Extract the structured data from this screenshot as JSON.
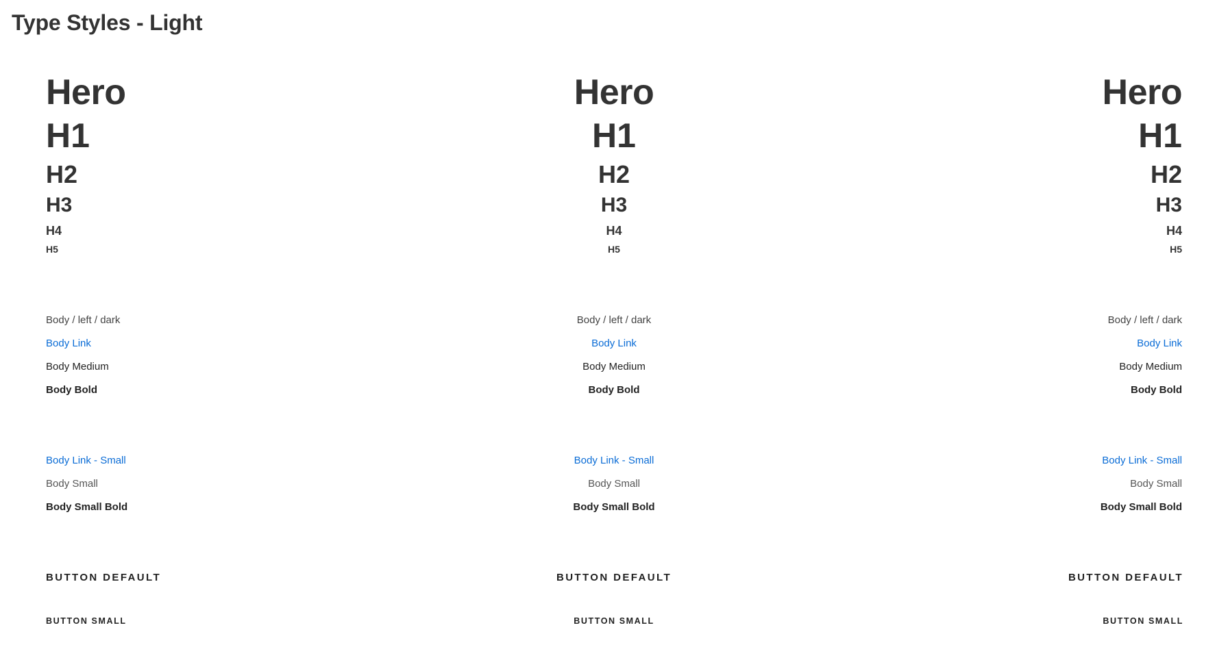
{
  "page": {
    "title": "Type Styles - Light"
  },
  "styles": {
    "hero": "Hero",
    "h1": "H1",
    "h2": "H2",
    "h3": "H3",
    "h4": "H4",
    "h5": "H5",
    "body_dark": "Body / left / dark",
    "body_link": "Body Link",
    "body_medium": "Body Medium",
    "body_bold": "Body Bold",
    "body_link_small": "Body Link - Small",
    "body_small": "Body Small",
    "body_small_bold": "Body Small Bold",
    "button_default": "BUTTON DEFAULT",
    "button_small": "BUTTON SMALL"
  },
  "colors": {
    "text_dark": "#333333",
    "link": "#0a6cd6",
    "background": "#ffffff"
  }
}
